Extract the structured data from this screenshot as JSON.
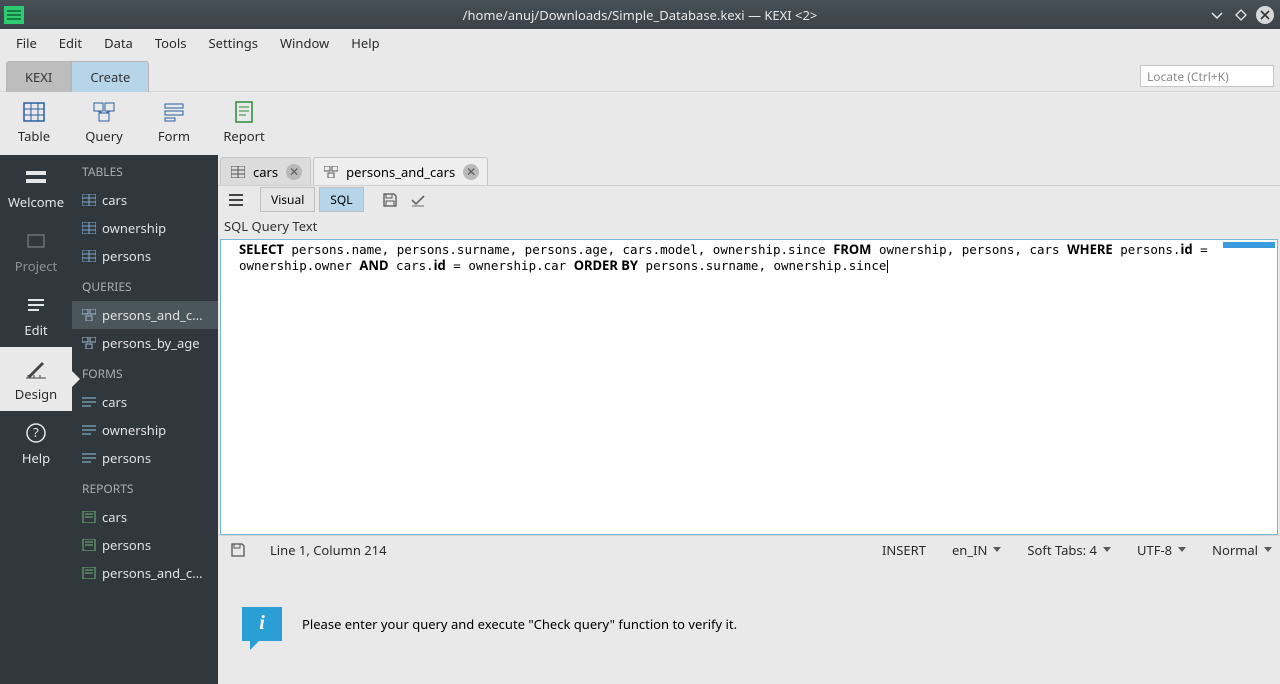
{
  "window": {
    "title": "/home/anuj/Downloads/Simple_Database.kexi — KEXI <2>"
  },
  "menu": {
    "items": [
      "File",
      "Edit",
      "Data",
      "Tools",
      "Settings",
      "Window",
      "Help"
    ]
  },
  "mainTabs": {
    "kexi": "KEXI",
    "create": "Create"
  },
  "locate": {
    "placeholder": "Locate (Ctrl+K)"
  },
  "toolbar": {
    "table": "Table",
    "query": "Query",
    "form": "Form",
    "report": "Report"
  },
  "leftnav": {
    "welcome": "Welcome",
    "project": "Project",
    "edit": "Edit",
    "design": "Design",
    "help": "Help"
  },
  "tree": {
    "tables_header": "TABLES",
    "tables": [
      "cars",
      "ownership",
      "persons"
    ],
    "queries_header": "QUERIES",
    "queries": [
      "persons_and_c...",
      "persons_by_age"
    ],
    "forms_header": "FORMS",
    "forms": [
      "cars",
      "ownership",
      "persons"
    ],
    "reports_header": "REPORTS",
    "reports": [
      "cars",
      "persons",
      "persons_and_c..."
    ]
  },
  "docTabs": {
    "tab0": {
      "label": "cars"
    },
    "tab1": {
      "label": "persons_and_cars"
    }
  },
  "editorToolbar": {
    "visual": "Visual",
    "sql": "SQL"
  },
  "sql": {
    "label": "SQL Query Text",
    "text_raw": "SELECT persons.name, persons.surname, persons.age, cars.model, ownership.since FROM ownership, persons, cars WHERE persons.id = ownership.owner AND cars.id = ownership.car ORDER BY persons.surname, ownership.since"
  },
  "status": {
    "position": "Line 1, Column 214",
    "insert": "INSERT",
    "locale": "en_IN",
    "tabs": "Soft Tabs: 4",
    "encoding": "UTF-8",
    "mode": "Normal"
  },
  "info": {
    "message": "Please enter your query and execute \"Check query\" function to verify it."
  }
}
